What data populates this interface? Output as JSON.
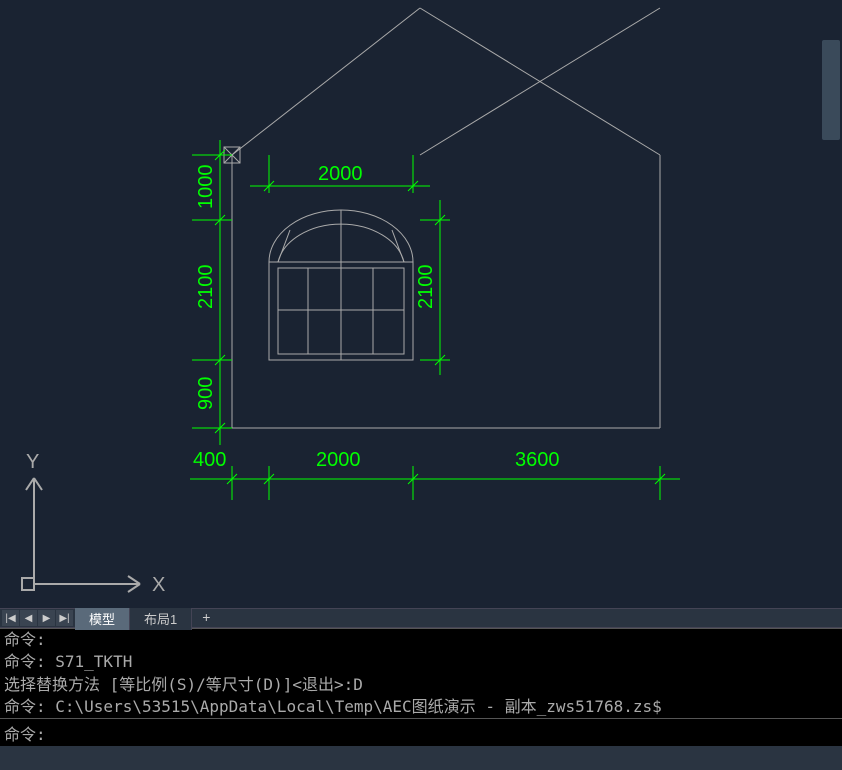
{
  "drawing": {
    "dimensions": {
      "horizontal": {
        "dim_2000_top": "2000",
        "dim_400": "400",
        "dim_2000_bottom": "2000",
        "dim_3600": "3600"
      },
      "vertical": {
        "dim_1000": "1000",
        "dim_2100_left": "2100",
        "dim_900": "900",
        "dim_2100_right": "2100"
      }
    },
    "axis": {
      "x_label": "X",
      "y_label": "Y"
    }
  },
  "tabs": {
    "active": "模型",
    "layout1": "布局1",
    "add": "+"
  },
  "nav": {
    "first": "|◀",
    "prev": "◀",
    "next": "▶",
    "last": "▶|"
  },
  "command_history": {
    "line1_prefix": "命令:",
    "line2": "命令: S71_TKTH",
    "line3": "选择替换方法 [等比例(S)/等尺寸(D)]<退出>:D",
    "line4": "命令: C:\\Users\\53515\\AppData\\Local\\Temp\\AEC图纸演示 - 副本_zws51768.zs$"
  },
  "command_input": {
    "prompt": "命令:",
    "value": ""
  }
}
